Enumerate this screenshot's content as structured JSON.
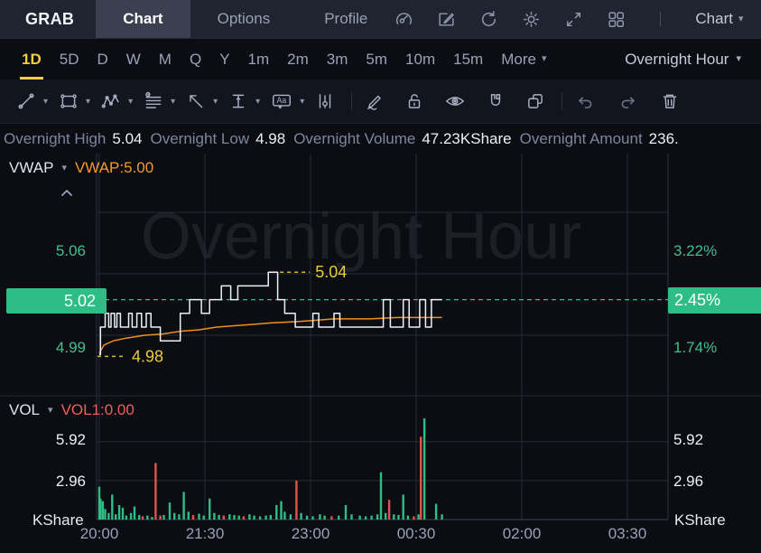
{
  "header": {
    "symbol": "GRAB",
    "tabs": [
      {
        "label": "Chart",
        "active": true
      },
      {
        "label": "Options",
        "active": false
      },
      {
        "label": "Profile",
        "active": false
      }
    ],
    "icon_names": [
      "gauge-icon",
      "edit-chart-icon",
      "refresh-icon",
      "settings-gear-icon",
      "fullscreen-icon",
      "layout-grid-icon"
    ],
    "view_dropdown_label": "Chart"
  },
  "timeframe_bar": {
    "items": [
      {
        "label": "1D",
        "active": true
      },
      {
        "label": "5D"
      },
      {
        "label": "D"
      },
      {
        "label": "W"
      },
      {
        "label": "M"
      },
      {
        "label": "Q"
      },
      {
        "label": "Y"
      },
      {
        "label": "1m"
      },
      {
        "label": "2m"
      },
      {
        "label": "3m"
      },
      {
        "label": "5m"
      },
      {
        "label": "10m"
      },
      {
        "label": "15m"
      }
    ],
    "more_label": "More",
    "session_label": "Overnight Hour"
  },
  "drawing_toolbar": {
    "tool_icon_names": [
      "trendline-icon",
      "rectangle-icon",
      "wave-pattern-icon",
      "gann-lines-icon",
      "arrow-icon",
      "price-range-icon",
      "text-note-icon",
      "candle-pattern-icon",
      "freehand-draw-icon",
      "unlock-icon",
      "visibility-eye-icon",
      "magnet-icon",
      "overlap-squares-icon",
      "undo-icon",
      "redo-icon",
      "trash-icon"
    ]
  },
  "info_bar": {
    "items": [
      {
        "label": "Overnight High",
        "value": "5.04"
      },
      {
        "label": "Overnight Low",
        "value": "4.98"
      },
      {
        "label": "Overnight Volume",
        "value": "47.23KShare"
      },
      {
        "label": "Overnight Amount",
        "value": "236."
      }
    ]
  },
  "price_panel": {
    "indicator_name": "VWAP",
    "indicator_value": "VWAP:5.00",
    "watermark": "Overnight Hour",
    "axis_left_top": "5.06",
    "axis_left_bottom": "4.99",
    "price_badge": "5.02",
    "axis_right_top": "3.22%",
    "axis_right_bottom": "1.74%",
    "change_badge": "2.45%"
  },
  "volume_panel": {
    "indicator_name": "VOL",
    "indicator_value": "VOL1:0.00",
    "axis_top": "5.92",
    "axis_bottom": "2.96",
    "unit_left": "KShare",
    "unit_right": "KShare"
  },
  "colors": {
    "accent_yellow": "#f2cf3f",
    "green": "#2ebd85",
    "orange": "#ef8e1f",
    "red": "#e2544a",
    "price_line": "#eef0f4",
    "grid": "#252c3a",
    "annotation_yellow": "#e9cc3a"
  },
  "chart_data": {
    "type": "line",
    "title_watermark": "Overnight Hour",
    "x_unit": "minutes since 20:00",
    "x_gridlines": [
      {
        "t": 0,
        "label": "20:00"
      },
      {
        "t": 90,
        "label": "21:30"
      },
      {
        "t": 180,
        "label": "23:00"
      },
      {
        "t": 270,
        "label": "00:30"
      },
      {
        "t": 360,
        "label": "02:00"
      },
      {
        "t": 450,
        "label": "03:30"
      }
    ],
    "price_axis": {
      "left_ticks": [
        "5.06",
        "5.02",
        "4.99"
      ],
      "right_ticks": [
        "3.22%",
        "2.45%",
        "1.74%"
      ],
      "current_price": 5.02,
      "current_change_pct": 2.45,
      "session_high": 5.04,
      "session_low": 4.98
    },
    "price_steps": [
      [
        0,
        4.98
      ],
      [
        1,
        5.0
      ],
      [
        5,
        5.01
      ],
      [
        8,
        5.0
      ],
      [
        10,
        5.01
      ],
      [
        13,
        5.0
      ],
      [
        15,
        5.01
      ],
      [
        18,
        5.0
      ],
      [
        25,
        5.01
      ],
      [
        28,
        5.0
      ],
      [
        32,
        5.01
      ],
      [
        36,
        5.0
      ],
      [
        40,
        5.01
      ],
      [
        44,
        5.0
      ],
      [
        52,
        4.99
      ],
      [
        69,
        5.01
      ],
      [
        77,
        5.02
      ],
      [
        87,
        5.01
      ],
      [
        94,
        5.02
      ],
      [
        104,
        5.03
      ],
      [
        112,
        5.02
      ],
      [
        118,
        5.03
      ],
      [
        144,
        5.04
      ],
      [
        152,
        5.02
      ],
      [
        158,
        5.01
      ],
      [
        167,
        5.0
      ],
      [
        182,
        5.01
      ],
      [
        187,
        5.0
      ],
      [
        200,
        5.01
      ],
      [
        205,
        5.0
      ],
      [
        242,
        5.02
      ],
      [
        248,
        5.0
      ],
      [
        259,
        5.02
      ],
      [
        264,
        5.0
      ],
      [
        273,
        5.02
      ],
      [
        278,
        5.0
      ],
      [
        283,
        5.02
      ],
      [
        292,
        5.02
      ]
    ],
    "vwap_line": [
      [
        0,
        4.981
      ],
      [
        4,
        4.987
      ],
      [
        12,
        4.99
      ],
      [
        23,
        4.992
      ],
      [
        38,
        4.994
      ],
      [
        54,
        4.995
      ],
      [
        69,
        4.997
      ],
      [
        85,
        4.998
      ],
      [
        100,
        5.0
      ],
      [
        115,
        5.001
      ],
      [
        131,
        5.002
      ],
      [
        146,
        5.003
      ],
      [
        169,
        5.004
      ],
      [
        185,
        5.005
      ],
      [
        200,
        5.006
      ],
      [
        231,
        5.006
      ],
      [
        254,
        5.007
      ],
      [
        292,
        5.007
      ]
    ],
    "annotations": [
      {
        "kind": "high",
        "label": "5.04",
        "price": 5.04,
        "t": 144
      },
      {
        "kind": "low",
        "label": "4.98",
        "price": 4.98,
        "t": 0
      }
    ],
    "volume_axis": {
      "ticks": [
        2.96,
        5.92
      ],
      "unit": "KShare",
      "vol1": 0.0
    },
    "volume_bars": [
      [
        0,
        2.5,
        "g"
      ],
      [
        1,
        1.6,
        "g"
      ],
      [
        3,
        1.4,
        "g"
      ],
      [
        5,
        0.8,
        "g"
      ],
      [
        8,
        0.5,
        "g"
      ],
      [
        11,
        1.9,
        "g"
      ],
      [
        14,
        0.4,
        "g"
      ],
      [
        17,
        1.1,
        "g"
      ],
      [
        20,
        0.9,
        "g"
      ],
      [
        23,
        0.3,
        "g"
      ],
      [
        27,
        0.5,
        "g"
      ],
      [
        30,
        1.0,
        "g"
      ],
      [
        34,
        0.35,
        "g"
      ],
      [
        37,
        0.25,
        "r"
      ],
      [
        41,
        0.3,
        "g"
      ],
      [
        45,
        0.2,
        "g"
      ],
      [
        48,
        4.3,
        "r"
      ],
      [
        52,
        0.3,
        "r"
      ],
      [
        55,
        0.35,
        "g"
      ],
      [
        60,
        1.3,
        "g"
      ],
      [
        64,
        0.5,
        "g"
      ],
      [
        68,
        0.4,
        "g"
      ],
      [
        72,
        2.1,
        "g"
      ],
      [
        76,
        0.6,
        "g"
      ],
      [
        80,
        0.35,
        "r"
      ],
      [
        85,
        0.45,
        "g"
      ],
      [
        89,
        0.3,
        "g"
      ],
      [
        94,
        1.6,
        "g"
      ],
      [
        98,
        0.5,
        "g"
      ],
      [
        102,
        0.35,
        "g"
      ],
      [
        106,
        0.3,
        "r"
      ],
      [
        111,
        0.4,
        "g"
      ],
      [
        115,
        0.35,
        "g"
      ],
      [
        119,
        0.3,
        "g"
      ],
      [
        123,
        0.25,
        "r"
      ],
      [
        128,
        0.4,
        "g"
      ],
      [
        132,
        0.3,
        "g"
      ],
      [
        137,
        0.25,
        "g"
      ],
      [
        142,
        0.3,
        "g"
      ],
      [
        146,
        0.35,
        "g"
      ],
      [
        151,
        1.1,
        "g"
      ],
      [
        155,
        1.4,
        "g"
      ],
      [
        158,
        0.6,
        "g"
      ],
      [
        163,
        0.4,
        "g"
      ],
      [
        168,
        2.96,
        "r"
      ],
      [
        172,
        0.5,
        "g"
      ],
      [
        177,
        0.3,
        "g"
      ],
      [
        182,
        0.25,
        "g"
      ],
      [
        188,
        0.4,
        "g"
      ],
      [
        192,
        0.3,
        "g"
      ],
      [
        198,
        0.25,
        "r"
      ],
      [
        204,
        0.3,
        "g"
      ],
      [
        210,
        1.1,
        "g"
      ],
      [
        215,
        0.4,
        "g"
      ],
      [
        222,
        0.3,
        "g"
      ],
      [
        227,
        0.25,
        "g"
      ],
      [
        232,
        0.3,
        "g"
      ],
      [
        237,
        0.4,
        "g"
      ],
      [
        240,
        3.6,
        "g"
      ],
      [
        244,
        0.5,
        "g"
      ],
      [
        247,
        1.5,
        "r"
      ],
      [
        251,
        0.4,
        "g"
      ],
      [
        255,
        0.35,
        "g"
      ],
      [
        259,
        1.9,
        "g"
      ],
      [
        263,
        0.3,
        "g"
      ],
      [
        268,
        0.25,
        "r"
      ],
      [
        272,
        0.4,
        "g"
      ],
      [
        274,
        6.3,
        "r"
      ],
      [
        277,
        7.7,
        "g"
      ],
      [
        287,
        1.2,
        "g"
      ],
      [
        292,
        0.4,
        "g"
      ]
    ]
  },
  "time_axis_unit_left": "KShare",
  "time_axis_unit_right": "KShare"
}
